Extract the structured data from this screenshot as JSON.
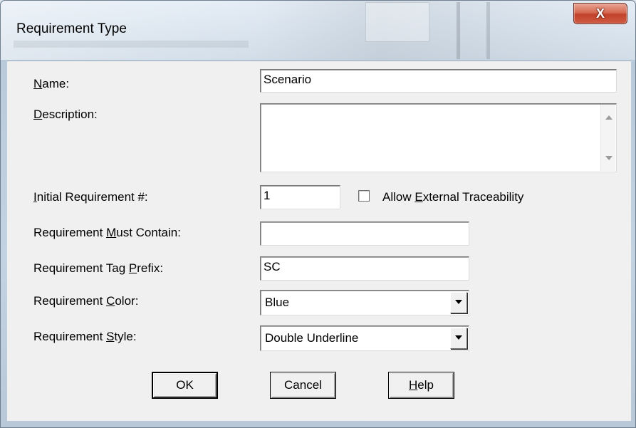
{
  "window": {
    "title": "Requirement Type",
    "close_label": "X"
  },
  "form": {
    "name_label": "Name:",
    "name_value": "Scenario",
    "description_label": "Description:",
    "description_value": "",
    "initial_req_label": "Initial Requirement #:",
    "initial_req_value": "1",
    "allow_external_label": "Allow External Traceability",
    "allow_external_checked": false,
    "must_contain_label": "Requirement Must Contain:",
    "must_contain_value": "",
    "tag_prefix_label": "Requirement Tag Prefix:",
    "tag_prefix_value": "SC",
    "color_label": "Requirement Color:",
    "color_value": "Blue",
    "style_label": "Requirement Style:",
    "style_value": "Double Underline"
  },
  "buttons": {
    "ok": "OK",
    "cancel": "Cancel",
    "help": "Help"
  },
  "icons": {
    "close": "close-icon",
    "dropdown": "chevron-down-icon",
    "scroll_up": "scroll-up-icon",
    "scroll_down": "scroll-down-icon"
  }
}
